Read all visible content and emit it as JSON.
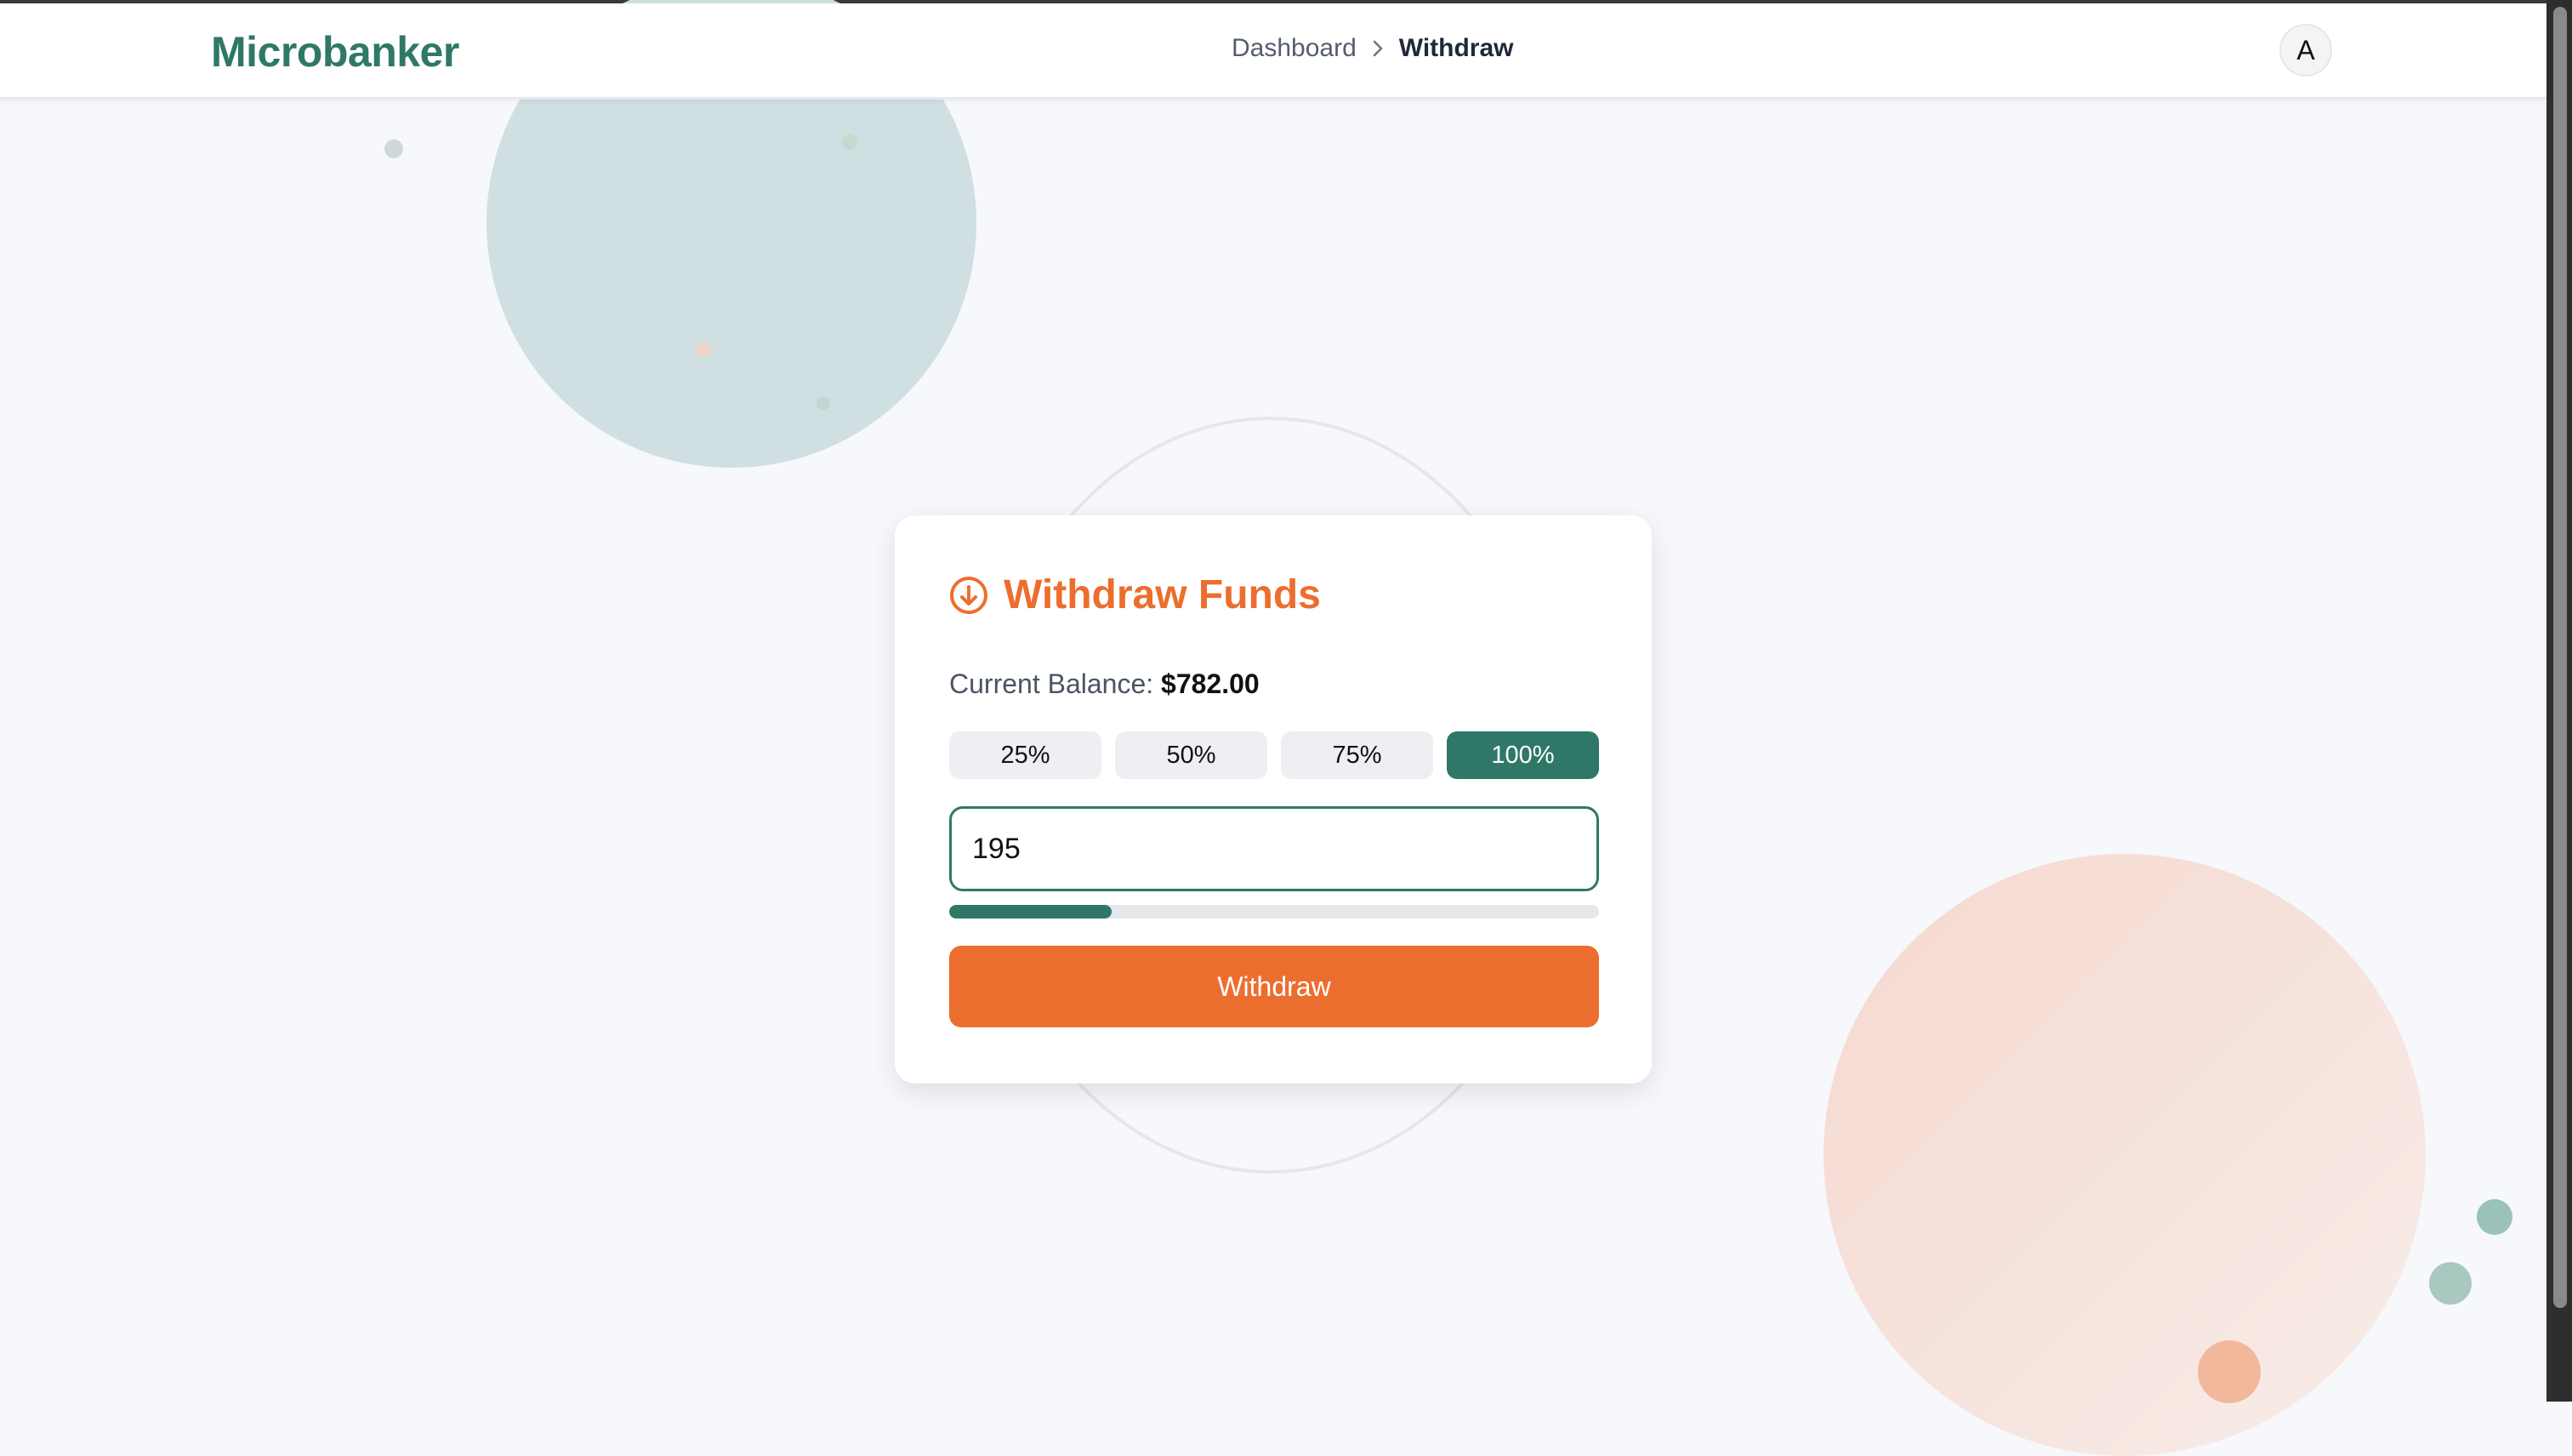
{
  "app": {
    "brand": "Microbanker"
  },
  "breadcrumb": {
    "items": [
      {
        "label": "Dashboard",
        "current": false
      },
      {
        "label": "Withdraw",
        "current": true
      }
    ]
  },
  "user": {
    "avatar_initial": "A"
  },
  "card": {
    "title": "Withdraw Funds",
    "icon": "arrow-down-circle-icon",
    "balance_label": "Current Balance:",
    "balance_value": "$782.00",
    "percent_options": [
      {
        "label": "25%",
        "selected": false
      },
      {
        "label": "50%",
        "selected": false
      },
      {
        "label": "75%",
        "selected": false
      },
      {
        "label": "100%",
        "selected": true
      }
    ],
    "amount_value": "195",
    "progress_fraction": 0.25,
    "submit_label": "Withdraw"
  },
  "colors": {
    "brand_teal": "#2f7868",
    "accent_orange": "#ec6e2e",
    "page_background": "#f7f8fc"
  }
}
